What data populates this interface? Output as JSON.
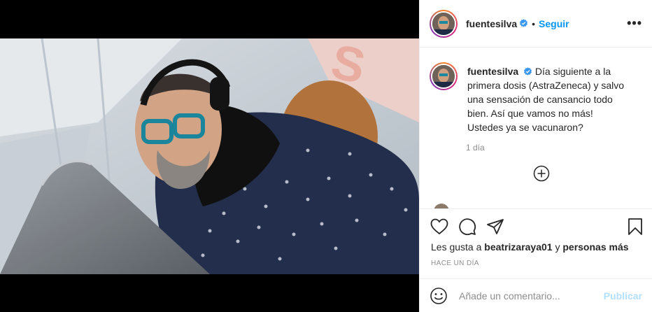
{
  "header": {
    "username": "fuentesilva",
    "separator": "•",
    "follow_label": "Seguir",
    "more_label": "•••"
  },
  "caption": {
    "username": "fuentesilva",
    "text": "Día siguiente a la primera dosis (AstraZeneca) y salvo una sensación de cansancio todo bien. Así que vamos no más! Ustedes ya se vacunaron?",
    "time": "1 día"
  },
  "likes": {
    "prefix": "Les gusta a ",
    "user": "beatrizaraya01",
    "joiner": " y ",
    "others": "personas más"
  },
  "posted_ago": "HACE UN DÍA",
  "comment_box": {
    "placeholder": "Añade un comentario...",
    "publish_label": "Publicar"
  },
  "colors": {
    "link_blue": "#0095f6",
    "publish_disabled": "#b2dffc",
    "verified_badge": "#3897f0",
    "muted": "#8e8e8e"
  },
  "icons": [
    "heart-icon",
    "comment-icon",
    "share-icon",
    "bookmark-icon",
    "emoji-icon",
    "add-comment-icon",
    "verified-badge-icon",
    "more-options-icon"
  ]
}
